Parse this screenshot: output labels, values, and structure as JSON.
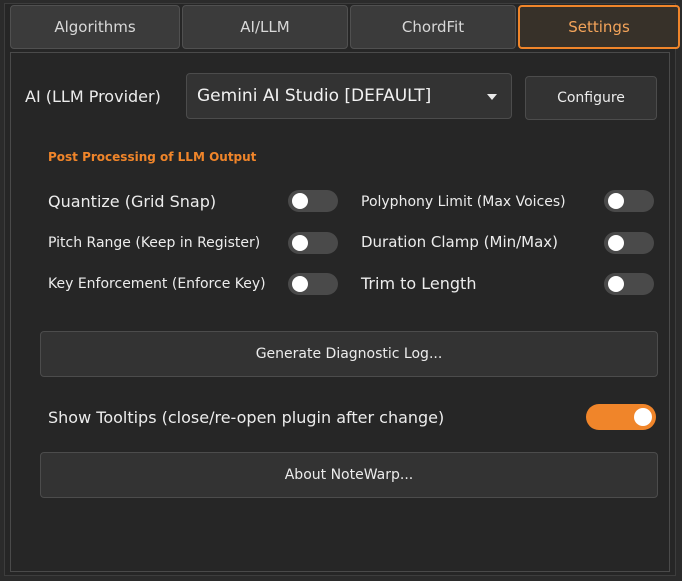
{
  "tabs": [
    {
      "label": "Algorithms"
    },
    {
      "label": "AI/LLM"
    },
    {
      "label": "ChordFit"
    },
    {
      "label": "Settings",
      "active": true
    }
  ],
  "provider": {
    "label": "AI (LLM Provider)",
    "selected": "Gemini AI Studio [DEFAULT]",
    "configure_label": "Configure"
  },
  "post_processing": {
    "title": "Post Processing of LLM Output",
    "options": [
      {
        "label": "Quantize (Grid Snap)",
        "enabled": false
      },
      {
        "label": "Polyphony Limit (Max Voices)",
        "enabled": false
      },
      {
        "label": "Pitch Range (Keep in Register)",
        "enabled": false
      },
      {
        "label": "Duration Clamp (Min/Max)",
        "enabled": false
      },
      {
        "label": "Key Enforcement (Enforce Key)",
        "enabled": false
      },
      {
        "label": "Trim to Length",
        "enabled": false
      }
    ]
  },
  "diagnostic_label": "Generate Diagnostic Log...",
  "tooltips": {
    "label": "Show Tooltips (close/re-open plugin after change)",
    "enabled": true
  },
  "about_label": "About NoteWarp...",
  "colors": {
    "accent": "#f0852a",
    "background": "#262626",
    "control": "#333333"
  }
}
